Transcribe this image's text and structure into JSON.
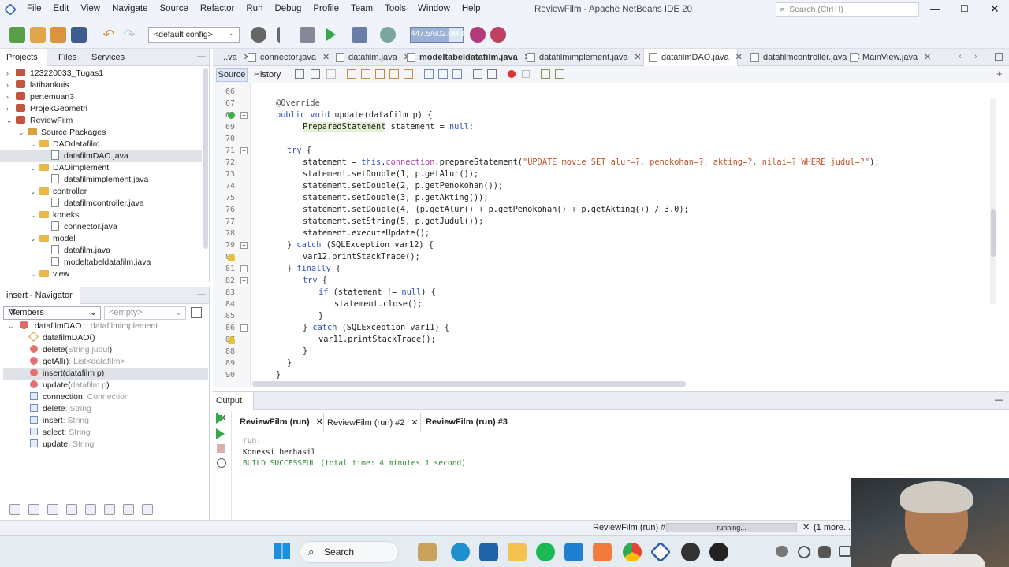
{
  "window": {
    "title": "ReviewFilm - Apache NetBeans IDE 20",
    "search_placeholder": "Search (Ctrl+I)",
    "menu": [
      "File",
      "Edit",
      "View",
      "Navigate",
      "Source",
      "Refactor",
      "Run",
      "Debug",
      "Profile",
      "Team",
      "Tools",
      "Window",
      "Help"
    ]
  },
  "toolbar": {
    "config": "<default config>",
    "memory": "447.5/602.0MB"
  },
  "projects_pane": {
    "tabs": [
      "Projects",
      "Files",
      "Services"
    ],
    "items": [
      {
        "label": "123220033_Tugas1",
        "kind": "project",
        "indent": 0,
        "open": false
      },
      {
        "label": "latihankuis",
        "kind": "project",
        "indent": 0,
        "open": false
      },
      {
        "label": "pertemuan3",
        "kind": "project",
        "indent": 0,
        "open": false
      },
      {
        "label": "ProjekGeometri",
        "kind": "project",
        "indent": 0,
        "open": false
      },
      {
        "label": "ReviewFilm",
        "kind": "project",
        "indent": 0,
        "open": true
      },
      {
        "label": "Source Packages",
        "kind": "folder",
        "indent": 1,
        "open": true
      },
      {
        "label": "DAOdatafilm",
        "kind": "package",
        "indent": 2,
        "open": true
      },
      {
        "label": "datafilmDAO.java",
        "kind": "file",
        "indent": 3,
        "selected": true
      },
      {
        "label": "DAOimplement",
        "kind": "package",
        "indent": 2,
        "open": true
      },
      {
        "label": "datafilmimplement.java",
        "kind": "file",
        "indent": 3
      },
      {
        "label": "controller",
        "kind": "package",
        "indent": 2,
        "open": true
      },
      {
        "label": "datafilmcontroller.java",
        "kind": "file",
        "indent": 3
      },
      {
        "label": "koneksi",
        "kind": "package",
        "indent": 2,
        "open": true
      },
      {
        "label": "connector.java",
        "kind": "file",
        "indent": 3
      },
      {
        "label": "model",
        "kind": "package",
        "indent": 2,
        "open": true
      },
      {
        "label": "datafilm.java",
        "kind": "file",
        "indent": 3
      },
      {
        "label": "modeltabeldatafilm.java",
        "kind": "file",
        "indent": 3
      },
      {
        "label": "view",
        "kind": "package",
        "indent": 2,
        "open": true
      }
    ]
  },
  "navigator": {
    "title": "insert - Navigator",
    "members_label": "Members",
    "filter_placeholder": "<empty>",
    "class_name": "datafilmDAO",
    "class_suffix": ":: datafilmimplement",
    "members": [
      {
        "name": "datafilmDAO()",
        "type": "",
        "kind": "constructor"
      },
      {
        "name": "delete(",
        "type": "String judul",
        "suffix": ")",
        "kind": "method"
      },
      {
        "name": "getAll()",
        "type": ": List<datafilm>",
        "kind": "method"
      },
      {
        "name": "insert(datafilm p)",
        "type": "",
        "kind": "method",
        "selected": true
      },
      {
        "name": "update(",
        "type": "datafilm p",
        "suffix": ")",
        "kind": "method"
      },
      {
        "name": "connection",
        "type": ": Connection",
        "kind": "field"
      },
      {
        "name": "delete",
        "type": ": String",
        "kind": "field"
      },
      {
        "name": "insert",
        "type": ": String",
        "kind": "field"
      },
      {
        "name": "select",
        "type": ": String",
        "kind": "field"
      },
      {
        "name": "update",
        "type": ": String",
        "kind": "field"
      }
    ]
  },
  "editor": {
    "tabs": [
      {
        "label": "...va",
        "active": false,
        "bold": false
      },
      {
        "label": "connector.java",
        "active": false,
        "bold": false
      },
      {
        "label": "datafilm.java",
        "active": false,
        "bold": false
      },
      {
        "label": "modeltabeldatafilm.java",
        "active": false,
        "bold": true
      },
      {
        "label": "datafilmimplement.java",
        "active": false,
        "bold": false
      },
      {
        "label": "datafilmDAO.java",
        "active": true,
        "bold": false
      },
      {
        "label": "datafilmcontroller.java",
        "active": false,
        "bold": false
      },
      {
        "label": "MainView.java",
        "active": false,
        "bold": false
      }
    ],
    "source_label": "Source",
    "history_label": "History",
    "lines": [
      {
        "n": "66",
        "code": ""
      },
      {
        "n": "67",
        "code": "@Override"
      },
      {
        "n": "68",
        "code": "public void update(datafilm p) {"
      },
      {
        "n": "69",
        "code": "PreparedStatement statement = null;"
      },
      {
        "n": "70",
        "code": ""
      },
      {
        "n": "71",
        "code": "try {"
      },
      {
        "n": "72",
        "code": "statement = this.connection.prepareStatement(\"UPDATE movie SET alur=?, penokohan=?, akting=?, nilai=? WHERE judul=?\");"
      },
      {
        "n": "73",
        "code": "statement.setDouble(1, p.getAlur());"
      },
      {
        "n": "74",
        "code": "statement.setDouble(2, p.getPenokohan());"
      },
      {
        "n": "75",
        "code": "statement.setDouble(3, p.getAkting());"
      },
      {
        "n": "76",
        "code": "statement.setDouble(4, (p.getAlur() + p.getPenokohan() + p.getAkting()) / 3.0);"
      },
      {
        "n": "77",
        "code": "statement.setString(5, p.getJudul());"
      },
      {
        "n": "78",
        "code": "statement.executeUpdate();"
      },
      {
        "n": "79",
        "code": "} catch (SQLException var12) {"
      },
      {
        "n": "80",
        "code": "var12.printStackTrace();"
      },
      {
        "n": "81",
        "code": "} finally {"
      },
      {
        "n": "82",
        "code": "try {"
      },
      {
        "n": "83",
        "code": "if (statement != null) {"
      },
      {
        "n": "84",
        "code": "statement.close();"
      },
      {
        "n": "85",
        "code": "}"
      },
      {
        "n": "86",
        "code": "} catch (SQLException var11) {"
      },
      {
        "n": "87",
        "code": "var11.printStackTrace();"
      },
      {
        "n": "88",
        "code": "}"
      },
      {
        "n": "89",
        "code": "}"
      },
      {
        "n": "90",
        "code": "}"
      }
    ]
  },
  "output": {
    "title": "Output",
    "tabs": [
      {
        "label": "ReviewFilm (run)",
        "bold": true,
        "closable": true
      },
      {
        "label": "ReviewFilm (run) #2",
        "bold": false,
        "closable": true
      },
      {
        "label": "ReviewFilm (run) #3",
        "bold": true,
        "closable": false
      }
    ],
    "lines": [
      {
        "text": "run:",
        "color": "#8a8a8a"
      },
      {
        "text": "Koneksi berhasil",
        "color": "#222222"
      },
      {
        "text": "BUILD SUCCESSFUL (total time: 4 minutes 1 second)",
        "color": "#2e8b2e"
      }
    ]
  },
  "status": {
    "task": "ReviewFilm (run) #3",
    "progress_text": "running...",
    "more": "(1 more...)"
  },
  "taskbar": {
    "search_label": "Search"
  },
  "colors": {
    "keyword": "#2f4fc9",
    "string": "#c1552a",
    "field": "#aa44aa",
    "success": "#2e8b2e",
    "selection": "#dfe3e8"
  }
}
